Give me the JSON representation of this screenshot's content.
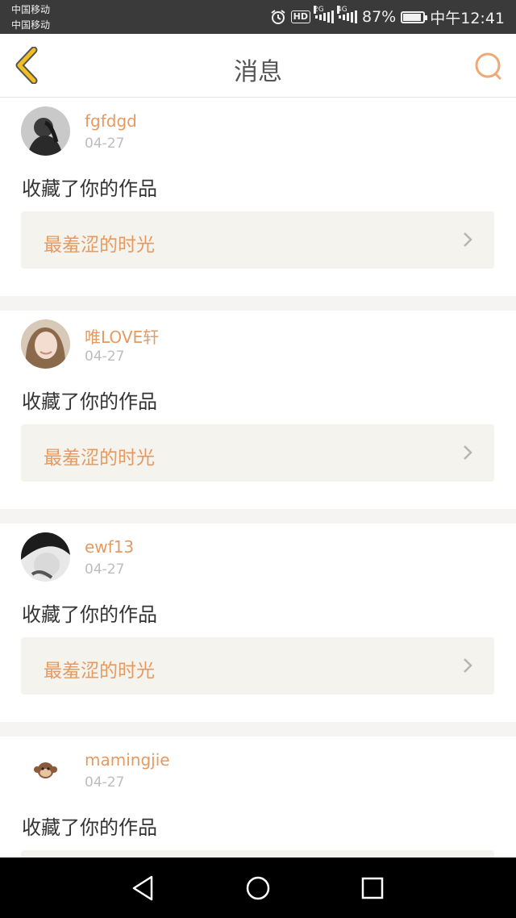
{
  "status_bar": {
    "carrier_1": "中国移动",
    "carrier_2": "中国移动",
    "battery_percent": "87%",
    "time": "中午12:41",
    "network_1": "2G",
    "network_2": "4G",
    "hd_label": "HD",
    "icons": [
      "alarm-icon",
      "hd-icon",
      "signal-icon",
      "signal-icon",
      "battery-icon"
    ]
  },
  "nav": {
    "title": "消息",
    "back_icon": "back-chevron-icon",
    "search_icon": "search-icon"
  },
  "messages": [
    {
      "username": "fgfdgd",
      "date": "04-27",
      "action": "收藏了你的作品",
      "work_title": "最羞涩的时光"
    },
    {
      "username": "唯LOVE轩",
      "date": "04-27",
      "action": "收藏了你的作品",
      "work_title": "最羞涩的时光"
    },
    {
      "username": "ewf13",
      "date": "04-27",
      "action": "收藏了你的作品",
      "work_title": "最羞涩的时光"
    },
    {
      "username": "mamingjie",
      "date": "04-27",
      "action": "收藏了你的作品",
      "work_title": ""
    }
  ],
  "system_nav": {
    "icons": [
      "back-triangle-icon",
      "home-circle-icon",
      "recents-square-icon"
    ]
  },
  "colors": {
    "accent": "#e59a61",
    "back_arrow": "#f2c01e",
    "status_bar_bg": "#3a3a3a",
    "card_link_bg": "#f4f3ee",
    "page_bg": "#f6f4f3"
  }
}
